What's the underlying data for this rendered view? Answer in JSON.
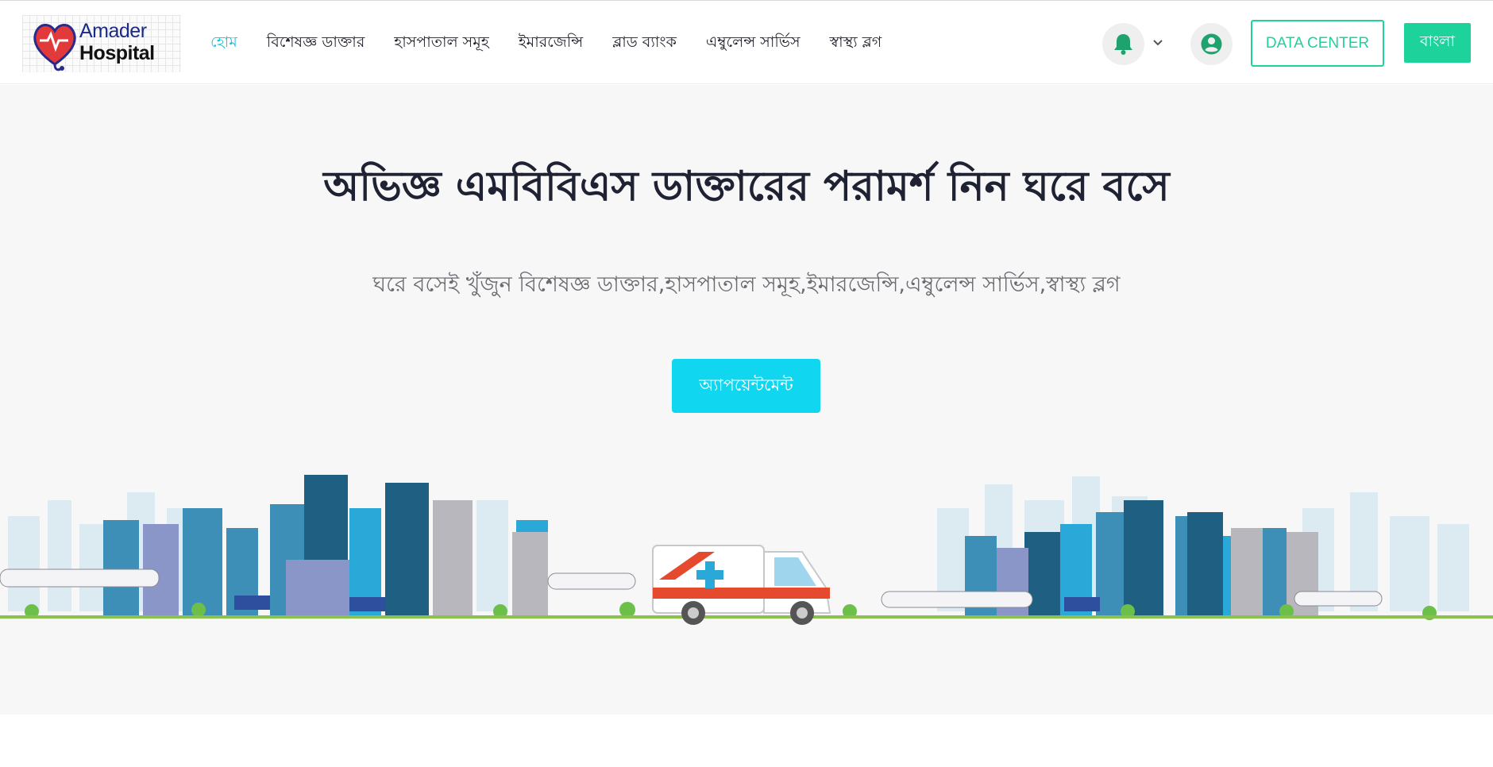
{
  "header": {
    "logo": {
      "line1": "Amader",
      "line2": "Hospital",
      "icon": "heart-stethoscope-icon"
    },
    "nav": [
      {
        "label": "হোম",
        "active": true
      },
      {
        "label": "বিশেষজ্ঞ ডাক্তার",
        "active": false
      },
      {
        "label": "হাসপাতাল সমূহ",
        "active": false
      },
      {
        "label": "ইমারজেন্সি",
        "active": false
      },
      {
        "label": "ব্লাড ব্যাংক",
        "active": false
      },
      {
        "label": "এম্বুলেন্স সার্ভিস",
        "active": false
      },
      {
        "label": "স্বাস্থ্য ব্লগ",
        "active": false
      }
    ],
    "notification_icon": "bell-icon",
    "user_icon": "user-circle-icon",
    "data_center_label": "DATA CENTER",
    "language_label": "বাংলা"
  },
  "hero": {
    "title": "অভিজ্ঞ এমবিবিএস ডাক্তারের পরামর্শ নিন ঘরে বসে",
    "subtitle": "ঘরে বসেই খুঁজুন বিশেষজ্ঞ ডাক্তার,হাসপাতাল সমূহ,ইমারজেন্সি,এম্বুলেন্স সার্ভিস,স্বাস্থ্য ব্লগ",
    "cta_label": "অ্যাপয়েন্টমেন্ট",
    "illustration": "city-skyline-with-ambulance"
  },
  "colors": {
    "accent_cyan": "#10d6f0",
    "active_nav": "#19c3dd",
    "green": "#1ed29b",
    "heading": "#1e2232",
    "hero_bg": "#f7f7f8"
  }
}
